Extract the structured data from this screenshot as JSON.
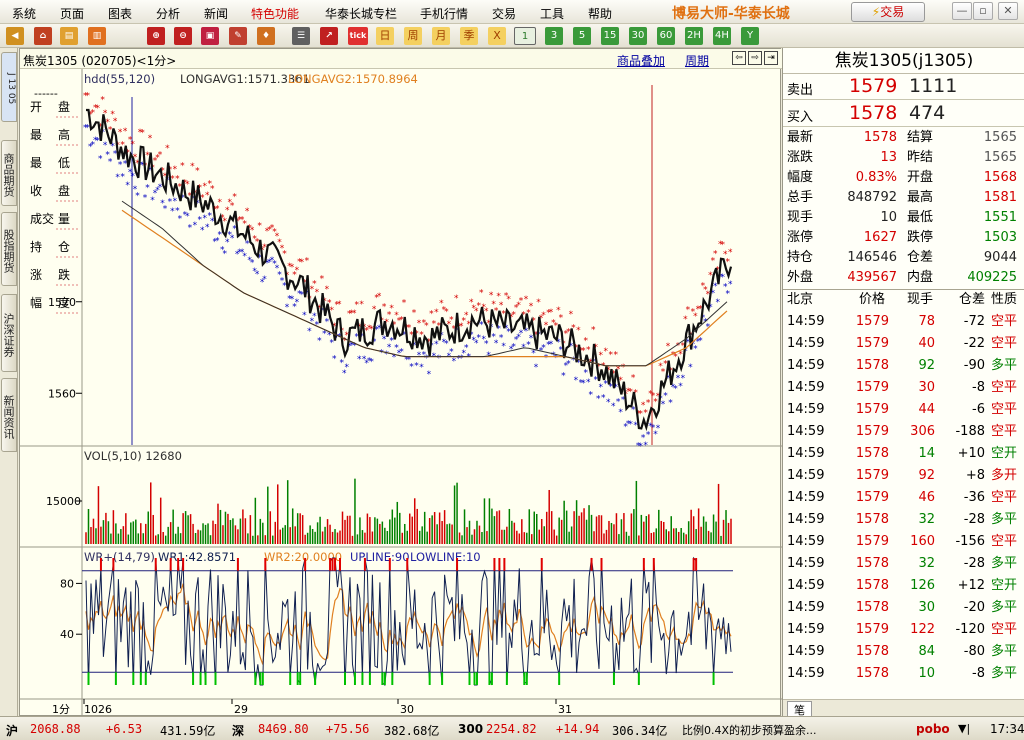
{
  "menu": {
    "items": [
      "系统",
      "页面",
      "图表",
      "分析",
      "新闻",
      "特色功能",
      "华泰长城专栏",
      "手机行情",
      "交易",
      "工具",
      "帮助"
    ],
    "highlight_index": 5,
    "brand": "博易大师-华泰长城",
    "trade_button": "交易"
  },
  "toolbar": {
    "text_buttons": [
      "日",
      "周",
      "月",
      "季",
      "X"
    ],
    "period_buttons": [
      "1",
      "3",
      "5",
      "15",
      "30",
      "60",
      "2H",
      "4H",
      "Y"
    ],
    "selected_period": "1",
    "icon_names": [
      "back-icon",
      "home-icon",
      "folder-icon",
      "chart-icon",
      "zoom-in-icon",
      "zoom-out-icon",
      "window-icon",
      "pencil-icon",
      "bell-icon",
      "list-icon",
      "line-chart-icon",
      "tick-icon"
    ],
    "tick_label": "tick"
  },
  "left_tabs": {
    "top_code": "J 13 05",
    "items": [
      "商品期货",
      "股指期货",
      "沪深证券",
      "新闻资讯"
    ]
  },
  "chart": {
    "header_code": "焦炭1305 (020705)<1分>",
    "overlay_link": "商品叠加",
    "period_link": "周期",
    "indicator": "hdd(55,120)",
    "longavg1": "LONGAVG1:1571.3361",
    "longavg2": "LONGAVG2:1570.8964",
    "info_legend": [
      {
        "label": "开",
        "value": "盘"
      },
      {
        "label": "最",
        "value": "高"
      },
      {
        "label": "最",
        "value": "低"
      },
      {
        "label": "收",
        "value": "盘"
      },
      {
        "label": "成交",
        "value": "量"
      },
      {
        "label": "持",
        "value": "仓"
      },
      {
        "label": "涨",
        "value": "跌"
      },
      {
        "label": "幅",
        "value": "度"
      }
    ],
    "price_ticks": [
      "1570",
      "1560"
    ],
    "vol_label": "VOL(5,10)",
    "vol_value": "12680",
    "vol_tick": "15000",
    "wr_label": "WR+(14,79)",
    "wr1": "WR1:42.8571",
    "wr2": "WR2:20.0000",
    "upline": "UPLINE:90",
    "lowline": "LOWLINE:10",
    "wr_ticks": [
      "80",
      "40"
    ],
    "x_labels": [
      "1分",
      "1026",
      "29",
      "30",
      "31"
    ]
  },
  "chart_data": {
    "type": "line",
    "title": "焦炭1305 (020705)<1分>",
    "series": [
      {
        "name": "LONGAVG1",
        "values": [
          1581,
          1578,
          1574,
          1571,
          1569,
          1567,
          1565,
          1564,
          1564,
          1564,
          1565,
          1564,
          1563,
          1563,
          1566,
          1570
        ]
      },
      {
        "name": "LONGAVG2",
        "values": [
          1580,
          1577,
          1574,
          1571,
          1569,
          1567,
          1565,
          1564,
          1564,
          1564,
          1564,
          1564,
          1563,
          1563,
          1565,
          1569
        ]
      },
      {
        "name": "price",
        "values": [
          1591,
          1586,
          1583,
          1580,
          1576,
          1572,
          1566,
          1568,
          1566,
          1568,
          1567,
          1566,
          1563,
          1557,
          1566,
          1575
        ]
      }
    ],
    "ylim": [
      1555,
      1595
    ],
    "wr_ylim": [
      0,
      100
    ]
  },
  "quote": {
    "title": "焦炭1305(j1305)",
    "sell_label": "卖出",
    "sell_price": "1579",
    "sell_volume": "1111",
    "buy_label": "买入",
    "buy_price": "1578",
    "buy_volume": "474",
    "stats": [
      {
        "l1": "最新",
        "v1": "1578",
        "c1": "red",
        "l2": "结算",
        "v2": "1565",
        "c2": "gray"
      },
      {
        "l1": "涨跌",
        "v1": "13",
        "c1": "red",
        "l2": "昨结",
        "v2": "1565",
        "c2": "gray"
      },
      {
        "l1": "幅度",
        "v1": "0.83%",
        "c1": "red",
        "l2": "开盘",
        "v2": "1568",
        "c2": "red"
      },
      {
        "l1": "总手",
        "v1": "848792",
        "c1": "dark",
        "l2": "最高",
        "v2": "1581",
        "c2": "red"
      },
      {
        "l1": "现手",
        "v1": "10",
        "c1": "dark",
        "l2": "最低",
        "v2": "1551",
        "c2": "green"
      },
      {
        "l1": "涨停",
        "v1": "1627",
        "c1": "red",
        "l2": "跌停",
        "v2": "1503",
        "c2": "green"
      },
      {
        "l1": "持仓",
        "v1": "146546",
        "c1": "dark",
        "l2": "仓差",
        "v2": "9044",
        "c2": "dark"
      },
      {
        "l1": "外盘",
        "v1": "439567",
        "c1": "red",
        "l2": "内盘",
        "v2": "409225",
        "c2": "green"
      }
    ],
    "tick_headers": [
      "北京",
      "价格",
      "现手",
      "仓差",
      "性质"
    ],
    "ticks": [
      {
        "time": "14:59",
        "price": "1579",
        "vol": "78",
        "diff": "-72",
        "type": "空平",
        "pc": "red",
        "vc": "red",
        "tc": "red"
      },
      {
        "time": "14:59",
        "price": "1579",
        "vol": "40",
        "diff": "-22",
        "type": "空平",
        "pc": "red",
        "vc": "red",
        "tc": "red"
      },
      {
        "time": "14:59",
        "price": "1578",
        "vol": "92",
        "diff": "-90",
        "type": "多平",
        "pc": "red",
        "vc": "green",
        "tc": "green"
      },
      {
        "time": "14:59",
        "price": "1579",
        "vol": "30",
        "diff": "-8",
        "type": "空平",
        "pc": "red",
        "vc": "red",
        "tc": "red"
      },
      {
        "time": "14:59",
        "price": "1579",
        "vol": "44",
        "diff": "-6",
        "type": "空平",
        "pc": "red",
        "vc": "red",
        "tc": "red"
      },
      {
        "time": "14:59",
        "price": "1579",
        "vol": "306",
        "diff": "-188",
        "type": "空平",
        "pc": "red",
        "vc": "red",
        "tc": "red"
      },
      {
        "time": "14:59",
        "price": "1578",
        "vol": "14",
        "diff": "+10",
        "type": "空开",
        "pc": "red",
        "vc": "green",
        "tc": "green"
      },
      {
        "time": "14:59",
        "price": "1579",
        "vol": "92",
        "diff": "+8",
        "type": "多开",
        "pc": "red",
        "vc": "red",
        "tc": "red"
      },
      {
        "time": "14:59",
        "price": "1579",
        "vol": "46",
        "diff": "-36",
        "type": "空平",
        "pc": "red",
        "vc": "red",
        "tc": "red"
      },
      {
        "time": "14:59",
        "price": "1578",
        "vol": "32",
        "diff": "-28",
        "type": "多平",
        "pc": "red",
        "vc": "green",
        "tc": "green"
      },
      {
        "time": "14:59",
        "price": "1579",
        "vol": "160",
        "diff": "-156",
        "type": "空平",
        "pc": "red",
        "vc": "red",
        "tc": "red"
      },
      {
        "time": "14:59",
        "price": "1578",
        "vol": "32",
        "diff": "-28",
        "type": "多平",
        "pc": "red",
        "vc": "green",
        "tc": "green"
      },
      {
        "time": "14:59",
        "price": "1578",
        "vol": "126",
        "diff": "+12",
        "type": "空开",
        "pc": "red",
        "vc": "green",
        "tc": "green"
      },
      {
        "time": "14:59",
        "price": "1578",
        "vol": "30",
        "diff": "-20",
        "type": "多平",
        "pc": "red",
        "vc": "green",
        "tc": "green"
      },
      {
        "time": "14:59",
        "price": "1579",
        "vol": "122",
        "diff": "-120",
        "type": "空平",
        "pc": "red",
        "vc": "red",
        "tc": "red"
      },
      {
        "time": "14:59",
        "price": "1578",
        "vol": "84",
        "diff": "-80",
        "type": "多平",
        "pc": "red",
        "vc": "green",
        "tc": "green"
      },
      {
        "time": "14:59",
        "price": "1578",
        "vol": "10",
        "diff": "-8",
        "type": "多平",
        "pc": "red",
        "vc": "green",
        "tc": "green"
      }
    ],
    "footer_tab": "笔"
  },
  "status": {
    "sh_label": "沪",
    "sh_value": "2068.88",
    "sh_change": "+6.53",
    "sh_amount": "431.59亿",
    "sz_label": "深",
    "sz_value": "8469.80",
    "sz_change": "+75.56",
    "sz_amount": "382.68亿",
    "i300_label": "300",
    "i300_value": "2254.82",
    "i300_change": "+14.94",
    "i300_amount": "306.34亿",
    "news": "比例0.4X的初步预算盈余...",
    "logo": "pobo",
    "time": "17:34"
  },
  "colors": {
    "up": "#d40000",
    "down": "#0000c0",
    "vol_up": "#d40000",
    "vol_down": "#008000",
    "avg1": "#303030",
    "avg2": "#e08020",
    "wr1": "#102050",
    "wr2": "#e08020"
  }
}
